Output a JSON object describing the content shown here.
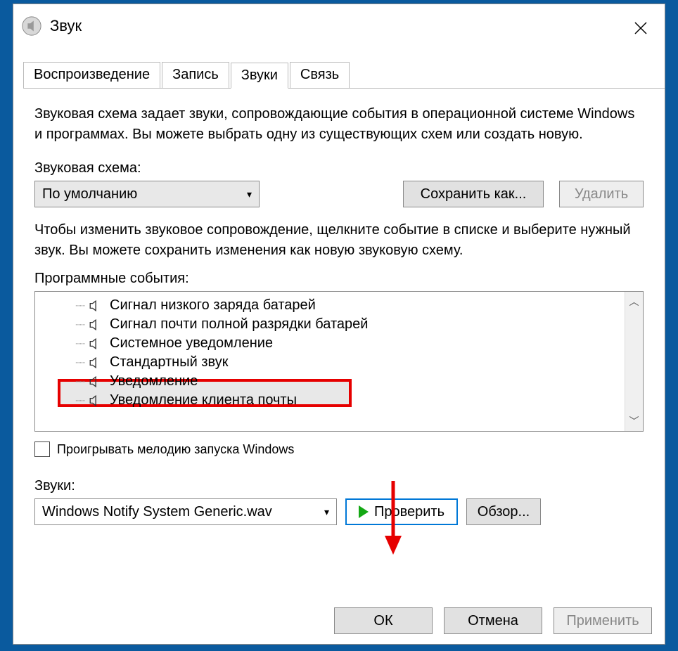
{
  "window": {
    "title": "Звук"
  },
  "tabs": {
    "playback": "Воспроизведение",
    "recording": "Запись",
    "sounds": "Звуки",
    "communications": "Связь",
    "active": "sounds"
  },
  "sounds_tab": {
    "description": "Звуковая схема задает звуки, сопровождающие события в операционной системе Windows и программах. Вы можете выбрать одну из существующих схем или создать новую.",
    "scheme_label": "Звуковая схема:",
    "scheme_value": "По умолчанию",
    "save_as_label": "Сохранить как...",
    "delete_label": "Удалить",
    "events_description": "Чтобы изменить звуковое сопровождение, щелкните событие в списке и выберите нужный звук. Вы можете сохранить изменения как новую звуковую схему.",
    "events_label": "Программные события:",
    "events": [
      "Сигнал низкого заряда батарей",
      "Сигнал почти полной разрядки батарей",
      "Системное уведомление",
      "Стандартный звук",
      "Уведомление",
      "Уведомление клиента почты"
    ],
    "selected_event_index": 4,
    "play_startup_label": "Проигрывать мелодию запуска Windows",
    "sounds_label": "Звуки:",
    "sound_file_value": "Windows Notify System Generic.wav",
    "test_label": "Проверить",
    "browse_label": "Обзор..."
  },
  "buttons": {
    "ok": "ОК",
    "cancel": "Отмена",
    "apply": "Применить"
  }
}
